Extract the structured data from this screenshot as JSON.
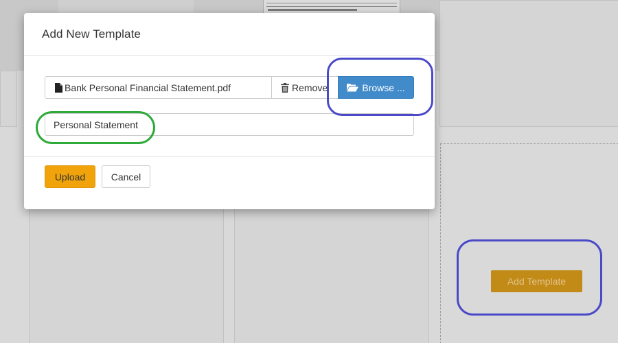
{
  "modal": {
    "title": "Add New Template",
    "file_name": "Bank Personal Financial Statement.pdf",
    "remove_label": "Remove",
    "browse_label": "Browse ...",
    "template_name_value": "Personal Statement",
    "upload_label": "Upload",
    "cancel_label": "Cancel"
  },
  "background": {
    "add_template_label": "Add Template"
  },
  "icons": {
    "file": "file-icon",
    "remove": "trash-icon",
    "browse": "folder-open-icon"
  },
  "colors": {
    "browse_button": "#428bca",
    "upload_button": "#f0a30a",
    "add_template_button": "#c28a16",
    "annotation_blue": "#4a4ac8",
    "annotation_green": "#2eaa3a"
  }
}
